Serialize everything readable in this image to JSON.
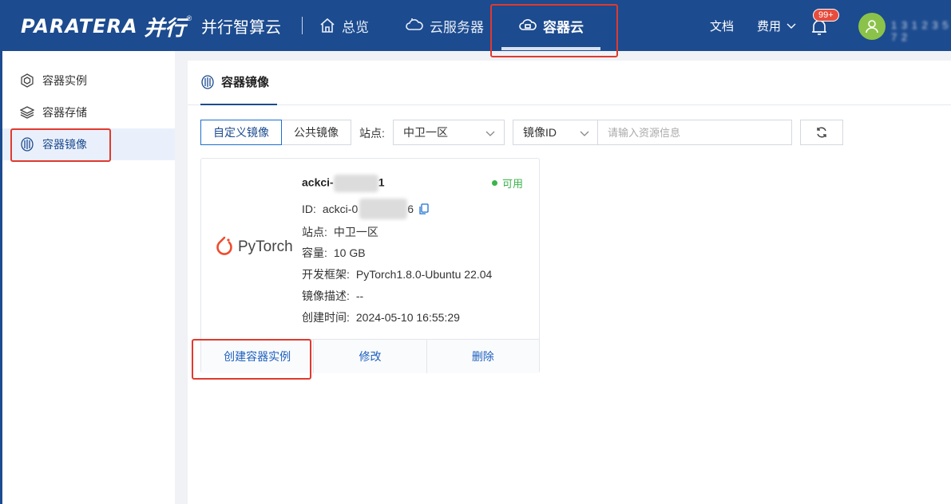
{
  "header": {
    "logo_en": "PARATERA",
    "logo_cn": "并行",
    "logo_reg": "®",
    "brand": "并行智算云",
    "nav": [
      {
        "label": "总览",
        "icon": "home-icon"
      },
      {
        "label": "云服务器",
        "icon": "cloud-server-icon"
      },
      {
        "label": "容器云",
        "icon": "container-cloud-icon",
        "active": true
      }
    ],
    "docs": "文档",
    "fees": "费用",
    "notification_badge": "99+",
    "username": "1 3 1 2 3 5 7 2"
  },
  "sidebar": {
    "items": [
      {
        "label": "容器实例",
        "icon": "container-instance-icon"
      },
      {
        "label": "容器存储",
        "icon": "storage-layers-icon"
      },
      {
        "label": "容器镜像",
        "icon": "container-image-icon",
        "active": true
      }
    ]
  },
  "main": {
    "tab_label": "容器镜像",
    "filters": {
      "custom_image": "自定义镜像",
      "public_image": "公共镜像",
      "site_label": "站点:",
      "site_value": "中卫一区",
      "id_type": "镜像ID",
      "search_placeholder": "请输入资源信息"
    },
    "card": {
      "logo_text": "PyTorch",
      "name_prefix": "ackci-",
      "name_suffix": "1",
      "status": "可用",
      "id_label": "ID:",
      "id_prefix": "ackci-0",
      "id_suffix": "6",
      "site_label": "站点:",
      "site_value": "中卫一区",
      "capacity_label": "容量:",
      "capacity_value": "10 GB",
      "framework_label": "开发框架:",
      "framework_value": "PyTorch1.8.0-Ubuntu 22.04",
      "desc_label": "镜像描述:",
      "desc_value": "--",
      "created_label": "创建时间:",
      "created_value": "2024-05-10 16:55:29",
      "actions": {
        "create": "创建容器实例",
        "edit": "修改",
        "delete": "删除"
      }
    }
  },
  "colors": {
    "header_bg": "#1c4b8f",
    "accent": "#1c5fbf",
    "available": "#3bb54a",
    "highlight_box": "#e03a2e"
  }
}
